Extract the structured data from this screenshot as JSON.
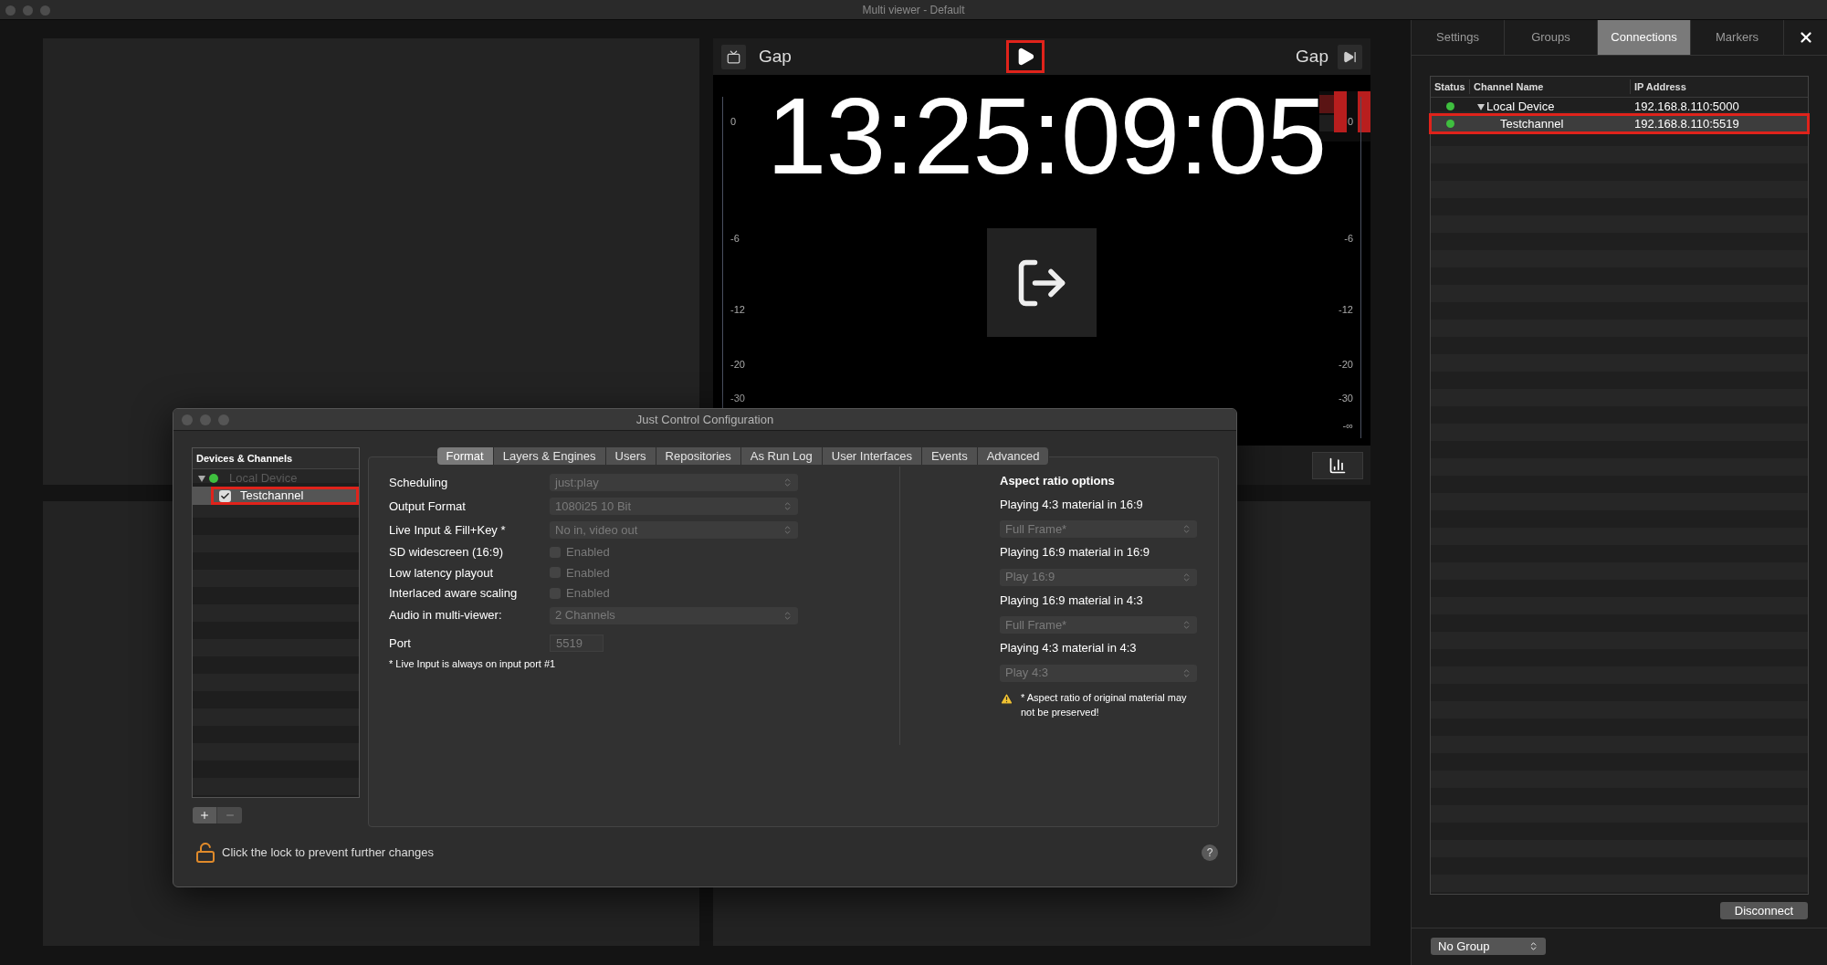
{
  "window": {
    "title": "Multi viewer - Default"
  },
  "player": {
    "left_label": "Gap",
    "right_label": "Gap",
    "timecode": "13:25:09:05",
    "meter_left_ticks": [
      "0",
      "-6",
      "-12",
      "-20",
      "-30"
    ],
    "meter_right_ticks": [
      "0",
      "-6",
      "-12",
      "-20",
      "-30",
      "-∞"
    ]
  },
  "side_panel": {
    "tabs": [
      {
        "label": "Settings",
        "selected": false
      },
      {
        "label": "Groups",
        "selected": false
      },
      {
        "label": "Connections",
        "selected": true
      },
      {
        "label": "Markers",
        "selected": false
      }
    ],
    "table": {
      "columns": [
        "Status",
        "Channel Name",
        "IP Address"
      ],
      "rows": [
        {
          "name": "Local Device",
          "address": "192.168.8.110:5000",
          "connected": true,
          "selected": false,
          "expanded": true,
          "children": [
            {
              "name": "Testchannel",
              "address": "192.168.8.110:5519",
              "connected": true,
              "selected": true
            }
          ]
        }
      ]
    },
    "disconnect_button": "Disconnect",
    "group_select": {
      "value": "No Group"
    }
  },
  "dialog": {
    "title": "Just Control Configuration",
    "devices": {
      "header": "Devices & Channels",
      "items": [
        {
          "name": "Local Device",
          "connected": true,
          "disabled": true,
          "expanded": true,
          "selected": false,
          "children": [
            {
              "name": "Testchannel",
              "checked": true,
              "selected": true
            }
          ]
        }
      ]
    },
    "tabs": [
      {
        "label": "Format",
        "selected": true
      },
      {
        "label": "Layers & Engines",
        "selected": false
      },
      {
        "label": "Users",
        "selected": false
      },
      {
        "label": "Repositories",
        "selected": false
      },
      {
        "label": "As Run Log",
        "selected": false
      },
      {
        "label": "User Interfaces",
        "selected": false
      },
      {
        "label": "Events",
        "selected": false
      },
      {
        "label": "Advanced",
        "selected": false
      }
    ],
    "form": {
      "disabled": true,
      "rows": [
        {
          "kind": "select",
          "label": "Scheduling",
          "value": "just:play"
        },
        {
          "kind": "select",
          "label": "Output Format",
          "value": "1080i25 10 Bit"
        },
        {
          "kind": "select",
          "label": "Live Input & Fill+Key *",
          "value": "No in, video out"
        },
        {
          "kind": "checkbox",
          "label": "SD widescreen (16:9)",
          "option": "Enabled",
          "checked": false
        },
        {
          "kind": "checkbox",
          "label": "Low latency playout",
          "option": "Enabled",
          "checked": false
        },
        {
          "kind": "checkbox",
          "label": "Interlaced aware scaling",
          "option": "Enabled",
          "checked": false
        },
        {
          "kind": "select",
          "label": "Audio in multi-viewer:",
          "value": "2 Channels"
        },
        {
          "kind": "field",
          "label": "Port",
          "value": "5519"
        }
      ],
      "note": "* Live Input is always on input port #1"
    },
    "aspect": {
      "title": "Aspect ratio options",
      "options": [
        {
          "label": "Playing 4:3 material in 16:9",
          "value": "Full Frame*"
        },
        {
          "label": "Playing 16:9 material in 16:9",
          "value": "Play 16:9"
        },
        {
          "label": "Playing 16:9 material in 4:3",
          "value": "Full Frame*"
        },
        {
          "label": "Playing 4:3 material in 4:3",
          "value": "Play 4:3"
        }
      ],
      "warning": "* Aspect ratio of original material may not be preserved!"
    },
    "lock": {
      "locked": false,
      "text": "Click the lock to prevent further changes"
    },
    "help_button": "?"
  }
}
